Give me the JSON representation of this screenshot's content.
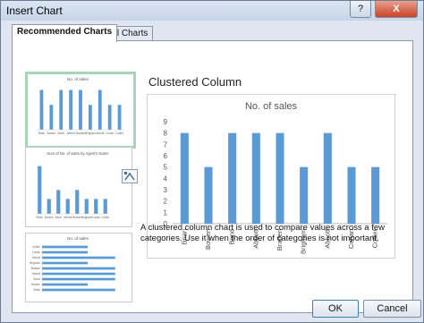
{
  "window": {
    "title": "Insert Chart",
    "help_glyph": "?",
    "close_glyph": "X"
  },
  "tabs": [
    {
      "label": "Recommended Charts",
      "active": true
    },
    {
      "label": "All Charts",
      "active": false
    }
  ],
  "preview": {
    "chart_name": "Clustered Column",
    "description": "A clustered column chart is used to compare values across a few categories. Use it when the order of categories is not important."
  },
  "thumbnails": [
    {
      "title": "No. of sales",
      "selected": true
    },
    {
      "title": "Sum of No. of sales by Agent's Name",
      "selected": false
    },
    {
      "title": "No. of sales",
      "selected": false
    }
  ],
  "buttons": {
    "ok": "OK",
    "cancel": "Cancel"
  },
  "colors": {
    "bar": "#5b9bd5",
    "selected_border": "#a5d7b6"
  },
  "chart_data": {
    "type": "bar",
    "title": "No. of sales",
    "categories": [
      "Brian",
      "Bowen",
      "Bond",
      "Abbott",
      "Braden",
      "Brigham",
      "Abbott",
      "Conan",
      "Collier"
    ],
    "values": [
      8,
      5,
      8,
      8,
      8,
      5,
      8,
      5,
      5
    ],
    "ylim": [
      0,
      9
    ],
    "yticks": [
      0,
      1,
      2,
      3,
      4,
      5,
      6,
      7,
      8,
      9
    ],
    "grid": false
  },
  "chart2_data": {
    "type": "bar",
    "title": "Sum of No. of sales by Agent's Name",
    "categories": [
      "Brian",
      "Bowen",
      "Bond",
      "Abbott",
      "Braden",
      "Brigham",
      "Conan",
      "Collier"
    ],
    "values": [
      16,
      5,
      8,
      5,
      8,
      5,
      5,
      5
    ],
    "ylim": [
      0,
      18
    ]
  },
  "chart3_data": {
    "type": "bar",
    "title": "No. of sales",
    "orientation": "horizontal",
    "categories": [
      "Collier",
      "Conan",
      "Abbott",
      "Brigham",
      "Braden",
      "Abbott",
      "Bond",
      "Bowen",
      "Brian"
    ],
    "values": [
      5,
      5,
      8,
      5,
      8,
      8,
      8,
      5,
      8
    ],
    "xlim": [
      0,
      9
    ]
  }
}
